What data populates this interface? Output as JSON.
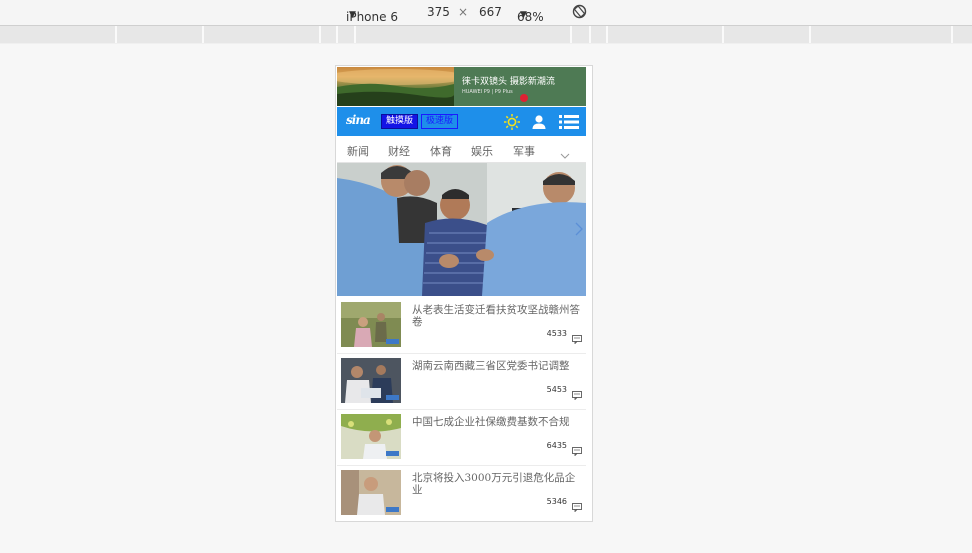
{
  "toolbar": {
    "device": "iPhone 6",
    "width": "375",
    "times": "×",
    "height": "667",
    "zoom": "68%"
  },
  "ad": {
    "headline": "徕卡双镜头 摄影新潮流",
    "subline": "HUAWEI P9 | P9 Plus"
  },
  "header": {
    "logo": "sina",
    "mode_touch": "触摸版",
    "mode_fast": "极速版"
  },
  "nav": {
    "items": [
      "新闻",
      "财经",
      "体育",
      "娱乐",
      "军事"
    ],
    "expand_icon": "chevron-down-icon"
  },
  "news": [
    {
      "title": "从老表生活变迁看扶贫攻坚战赣州答卷",
      "comments": "4533"
    },
    {
      "title": "湖南云南西藏三省区党委书记调整",
      "comments": "5453"
    },
    {
      "title": "中国七成企业社保缴费基数不合规",
      "comments": "6435"
    },
    {
      "title": "北京将投入3000万元引退危化品企业",
      "comments": "5346"
    }
  ],
  "colors": {
    "header_blue": "#1e8fea",
    "touch_mode_bg": "#1414e6",
    "sun_icon": "#f5e11a"
  }
}
